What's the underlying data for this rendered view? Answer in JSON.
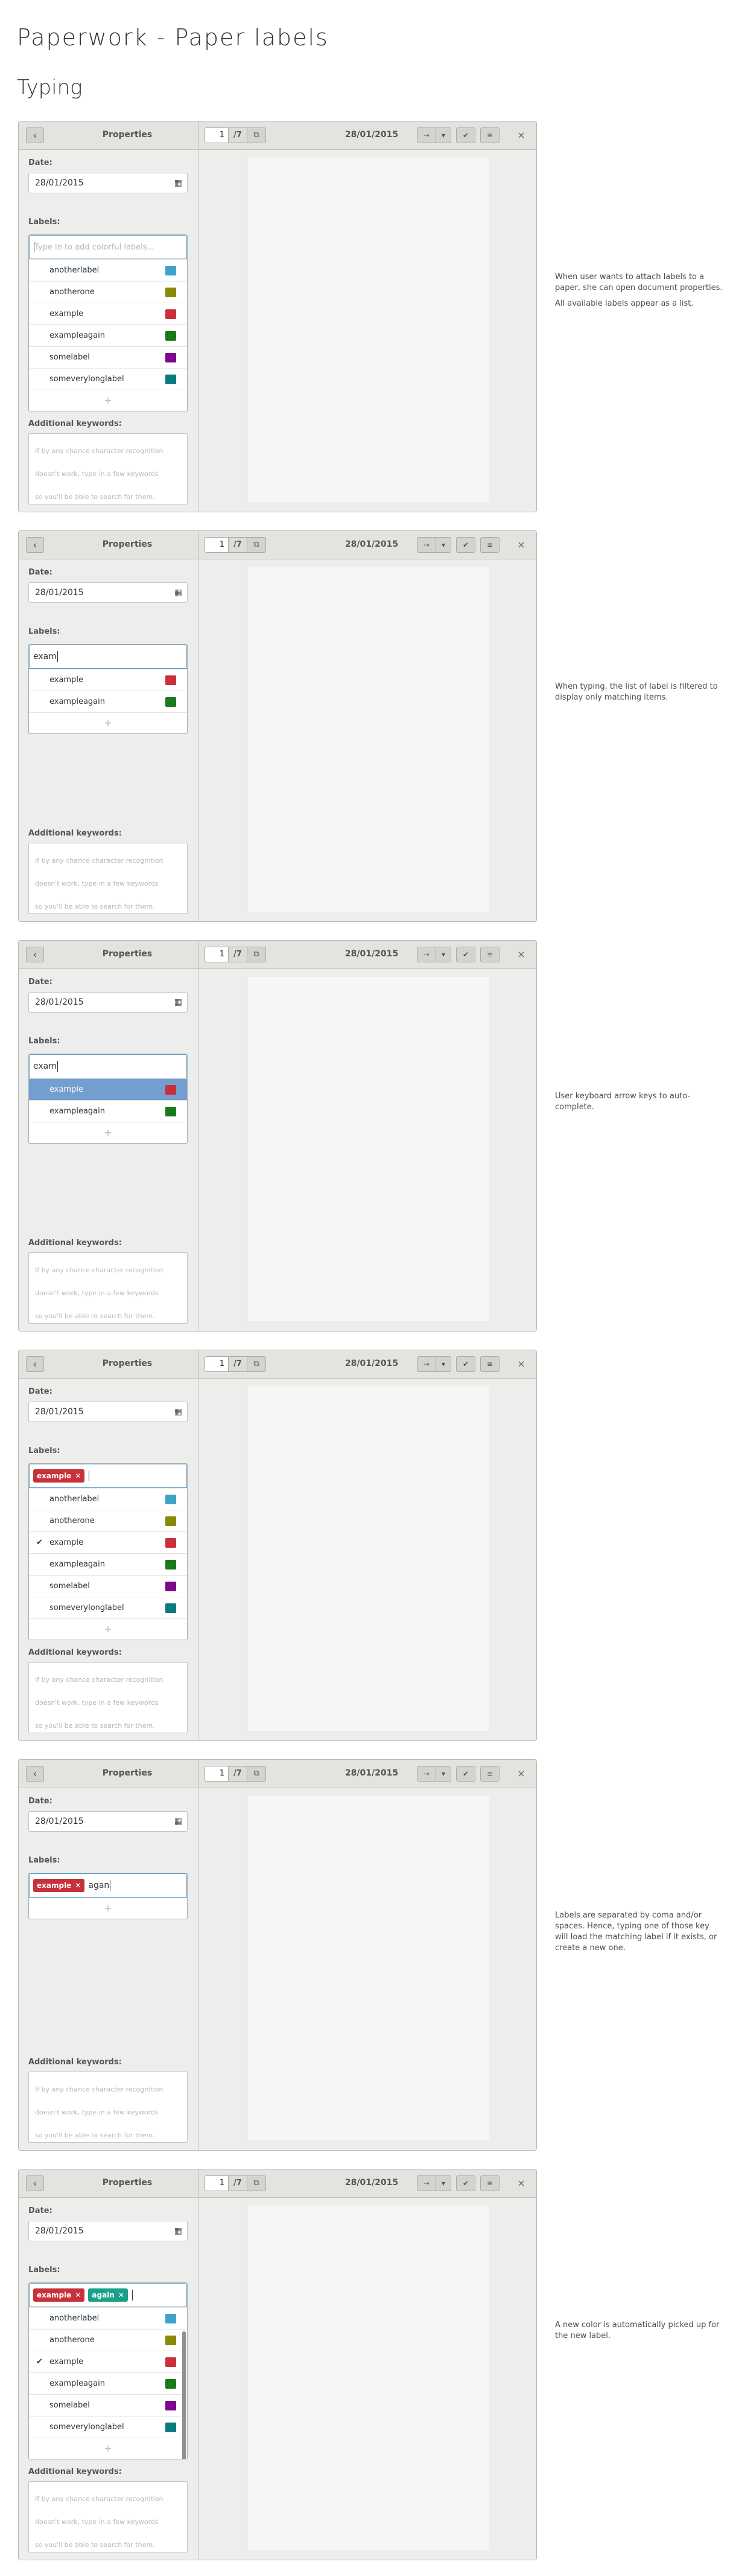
{
  "page": {
    "title": "Paperwork - Paper labels",
    "section": "Typing"
  },
  "common": {
    "back_icon": "chevron-left-icon",
    "properties": "Properties",
    "page_current": "1",
    "page_total": "/7",
    "doc_date": "28/01/2015",
    "date_label": "Date:",
    "date_value": "28/01/2015",
    "labels_label": "Labels:",
    "labels_placeholder": "Type in to add colorful labels...",
    "keywords_label": "Additional keywords:",
    "keywords_placeholder_lines": [
      "If by any chance character recognition",
      "doesn't work, type in a few keywords",
      "so you'll be able to search for them."
    ],
    "plus": "+",
    "close": "×",
    "colors": {
      "anotherlabel": "#3fa3c8",
      "anotherone": "#8a8a0a",
      "example": "#c8303a",
      "exampleagain": "#1a7a1a",
      "somelabel": "#7a0a8a",
      "someverylonglabel": "#0a7a7a",
      "again": "#1aa088"
    }
  },
  "notes": [
    [
      "When user wants to attach labels to a paper, she can open document properties.",
      "All available labels appear as a list."
    ],
    [
      "When typing, the list of label is filtered to display only matching items."
    ],
    [
      "User keyboard arrow keys to auto-complete."
    ],
    [],
    [
      "Labels are separated by coma and/or spaces. Hence, typing one of those key will load the matching label if it exists, or create a new one."
    ],
    [
      "A new color is automatically picked up for the new label."
    ]
  ],
  "screens": [
    {
      "input_text": "",
      "tags": [],
      "items": [
        {
          "name": "anotherlabel",
          "checked": false,
          "selected": false
        },
        {
          "name": "anotherone",
          "checked": false,
          "selected": false
        },
        {
          "name": "example",
          "checked": false,
          "selected": false
        },
        {
          "name": "exampleagain",
          "checked": false,
          "selected": false
        },
        {
          "name": "somelabel",
          "checked": false,
          "selected": false
        },
        {
          "name": "someverylonglabel",
          "checked": false,
          "selected": false
        }
      ]
    },
    {
      "input_text": "exam",
      "tags": [],
      "items": [
        {
          "name": "example",
          "checked": false,
          "selected": false
        },
        {
          "name": "exampleagain",
          "checked": false,
          "selected": false
        }
      ]
    },
    {
      "input_text": "exam",
      "tags": [],
      "items": [
        {
          "name": "example",
          "checked": false,
          "selected": true
        },
        {
          "name": "exampleagain",
          "checked": false,
          "selected": false
        }
      ]
    },
    {
      "input_text": "",
      "tags": [
        {
          "name": "example"
        }
      ],
      "items": [
        {
          "name": "anotherlabel",
          "checked": false,
          "selected": false
        },
        {
          "name": "anotherone",
          "checked": false,
          "selected": false
        },
        {
          "name": "example",
          "checked": true,
          "selected": false
        },
        {
          "name": "exampleagain",
          "checked": false,
          "selected": false
        },
        {
          "name": "somelabel",
          "checked": false,
          "selected": false
        },
        {
          "name": "someverylonglabel",
          "checked": false,
          "selected": false
        }
      ]
    },
    {
      "input_text": "agan",
      "tags": [
        {
          "name": "example"
        }
      ],
      "items": []
    },
    {
      "input_text": "",
      "tags": [
        {
          "name": "example"
        },
        {
          "name": "again"
        }
      ],
      "scrollbar": true,
      "items": [
        {
          "name": "anotherlabel",
          "checked": false,
          "selected": false
        },
        {
          "name": "anotherone",
          "checked": false,
          "selected": false
        },
        {
          "name": "example",
          "checked": true,
          "selected": false
        },
        {
          "name": "exampleagain",
          "checked": false,
          "selected": false
        },
        {
          "name": "somelabel",
          "checked": false,
          "selected": false
        },
        {
          "name": "someverylonglabel",
          "checked": false,
          "selected": false
        }
      ]
    }
  ]
}
